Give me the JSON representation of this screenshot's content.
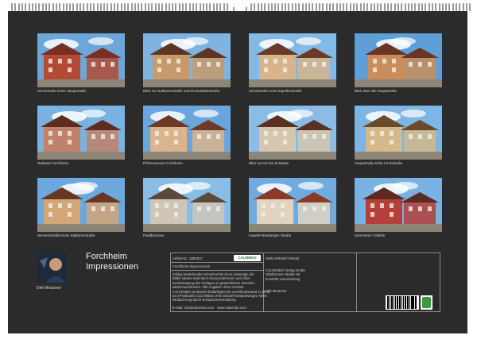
{
  "photos": [
    {
      "caption": "Schulstraße Ecke Hauptstraße",
      "sky": "#6da7d9",
      "building": "#b24a34",
      "roof": "#7a2f21"
    },
    {
      "caption": "Blick zur Sattlertorstraße und Einsiedeleinstraße",
      "sky": "#7fb4e0",
      "building": "#c79a6b",
      "roof": "#5e3522"
    },
    {
      "caption": "Schulstraße Ecke Kapellenstraße",
      "sky": "#83b9e6",
      "building": "#d8b48a",
      "roof": "#6b3a26"
    },
    {
      "caption": "Blick über die Hauptstraße",
      "sky": "#5f9fd8",
      "building": "#c98d5c",
      "roof": "#6a3523"
    },
    {
      "caption": "Rathaus Forchheim",
      "sky": "#7ab2e2",
      "building": "#c0826a",
      "roof": "#5d2e20"
    },
    {
      "caption": "Pfalzmuseum Forchheim",
      "sky": "#6aa6dc",
      "building": "#d9b48c",
      "roof": "#6e3a24"
    },
    {
      "caption": "Blick zur Kirche St.Martin",
      "sky": "#8bbce6",
      "building": "#d6c6ae",
      "roof": "#5a3020"
    },
    {
      "caption": "Hauptstraße Ecke Kirchstraße",
      "sky": "#7db5e4",
      "building": "#d4b98a",
      "roof": "#6b4a2a"
    },
    {
      "caption": "Wiesentstraße Ecke Sattlertorstraße",
      "sky": "#6ba8de",
      "building": "#d3a678",
      "roof": "#6a3624"
    },
    {
      "caption": "Paulibrunnen",
      "sky": "#88bde6",
      "building": "#cfc6b8",
      "roof": "#5b4a3a"
    },
    {
      "caption": "Kapelle Bamberger Straße",
      "sky": "#70abe0",
      "building": "#e0d4c0",
      "roof": "#8b3a2a"
    },
    {
      "caption": "Kammerer´s Mühle",
      "sky": "#79b1e3",
      "building": "#b3403a",
      "roof": "#5c2a22"
    }
  ],
  "title": {
    "line1": "Forchheim",
    "line2": "Impressionen"
  },
  "author": "Dirk Meutzner",
  "info": {
    "article_label": "Artikel-Nr.: 1992937",
    "logo_text": "CALVENDO",
    "product_title": "Forchheim Impressionen",
    "legal": [
      "Infolge bestehender Schutzrechte ist es untersagt, die",
      "Bilder dieses Kalenders herauszutrennen und ohne",
      "Genehmigung des Verlages zu gewerblichen Zwecken",
      "weiterzuverbreiten. Alle Angaben ohne Gewähr.",
      "CALVENDO produziert bedarfsgerecht und klimaneutral in DE &",
      "EU (Postbooks CO2-Bilanz ohne Druck/Transportwege). Mehr:",
      "Reduzierung durch Emissionsvermeidung"
    ],
    "contact": "E-Mail: info@calvendo.com · www.calvendo.com",
    "isbn": "ISBN 9783457790182",
    "publisher": [
      "CALVENDO Verlag GmbH",
      "Ottobrunner Straße 39",
      "D-82008 Unterhaching"
    ],
    "photographer": "Dirk Meutzner"
  }
}
